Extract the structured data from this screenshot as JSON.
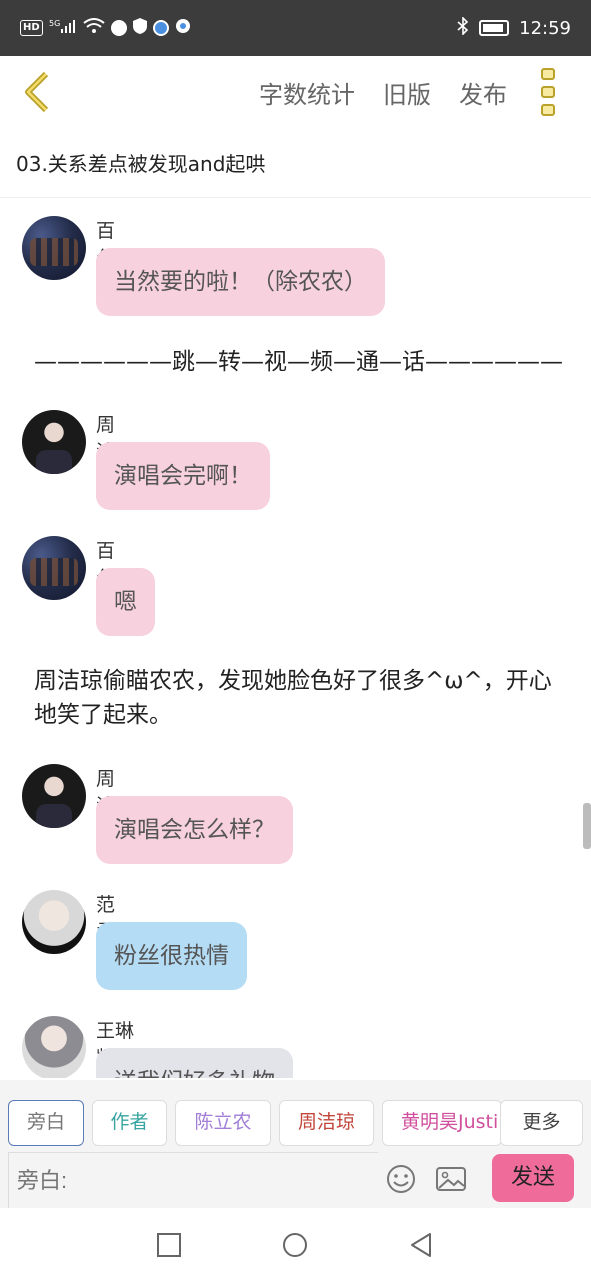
{
  "status_bar": {
    "network_badge": "HD",
    "signal_label": "5G",
    "time": "12:59"
  },
  "header": {
    "actions": [
      "字数统计",
      "旧版",
      "发布"
    ]
  },
  "chapter": {
    "title": "03.关系差点被发现and起哄"
  },
  "messages": [
    {
      "sender": "百分九",
      "text": "当然要的啦！（除农农）",
      "color": "pink"
    },
    {
      "narration": "——————跳—转—视—频—通—话——————"
    },
    {
      "sender": "周洁琼",
      "text": "演唱会完啊！",
      "color": "pink"
    },
    {
      "sender": "百分九",
      "text": "嗯",
      "color": "pink"
    },
    {
      "narration": "周洁琼偷瞄农农，发现她脸色好了很多^ω^，开心地笑了起来。"
    },
    {
      "sender": "周洁琼",
      "text": "演唱会怎么样？",
      "color": "pink"
    },
    {
      "sender": "范丞丞",
      "text": "粉丝很热情",
      "color": "blue"
    },
    {
      "sender": "王琳凯（小鬼）",
      "text": "送我们好多礼物",
      "color": "gray"
    }
  ],
  "roles": [
    {
      "label": "旁白",
      "color": "#777777"
    },
    {
      "label": "作者",
      "color": "#3aa5a0"
    },
    {
      "label": "陈立农",
      "color": "#a27ed6"
    },
    {
      "label": "周洁琼",
      "color": "#c2453a"
    },
    {
      "label": "黄明昊Justin",
      "color": "#d0509e"
    },
    {
      "label": "更多",
      "color": "#444444"
    }
  ],
  "composer": {
    "placeholder": "旁白:",
    "send_label": "发送"
  },
  "colors": {
    "bubble_pink": "#f7d1dd",
    "bubble_blue": "#b4dcf5",
    "send_button": "#ef6c9a",
    "accent_yellow": "#b9a12a"
  }
}
